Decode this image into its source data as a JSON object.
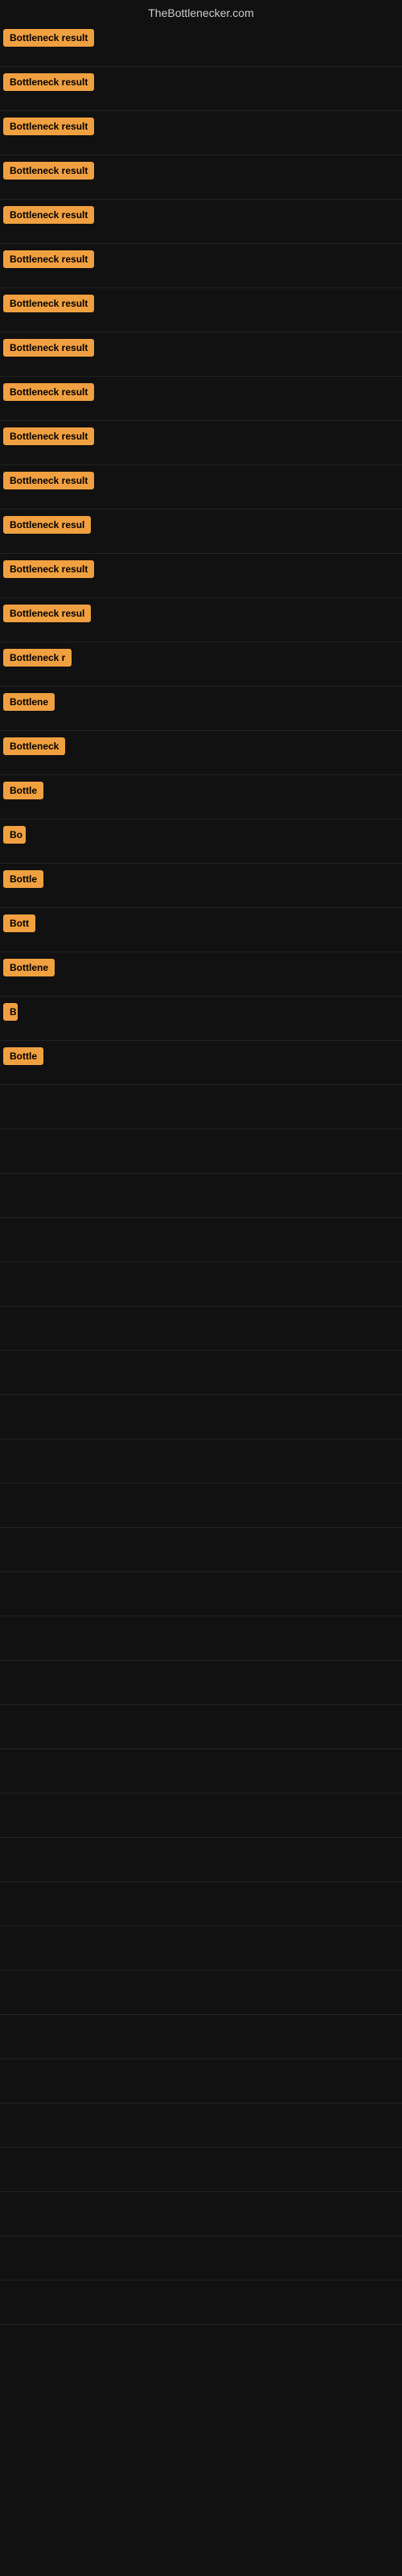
{
  "site": {
    "title": "TheBottlenecker.com"
  },
  "rows": [
    {
      "id": 1,
      "badge_text": "Bottleneck result",
      "width": 140
    },
    {
      "id": 2,
      "badge_text": "Bottleneck result",
      "width": 140
    },
    {
      "id": 3,
      "badge_text": "Bottleneck result",
      "width": 140
    },
    {
      "id": 4,
      "badge_text": "Bottleneck result",
      "width": 140
    },
    {
      "id": 5,
      "badge_text": "Bottleneck result",
      "width": 140
    },
    {
      "id": 6,
      "badge_text": "Bottleneck result",
      "width": 140
    },
    {
      "id": 7,
      "badge_text": "Bottleneck result",
      "width": 140
    },
    {
      "id": 8,
      "badge_text": "Bottleneck result",
      "width": 140
    },
    {
      "id": 9,
      "badge_text": "Bottleneck result",
      "width": 140
    },
    {
      "id": 10,
      "badge_text": "Bottleneck result",
      "width": 140
    },
    {
      "id": 11,
      "badge_text": "Bottleneck result",
      "width": 140
    },
    {
      "id": 12,
      "badge_text": "Bottleneck resul",
      "width": 120
    },
    {
      "id": 13,
      "badge_text": "Bottleneck result",
      "width": 130
    },
    {
      "id": 14,
      "badge_text": "Bottleneck resul",
      "width": 110
    },
    {
      "id": 15,
      "badge_text": "Bottleneck r",
      "width": 90
    },
    {
      "id": 16,
      "badge_text": "Bottlene",
      "width": 72
    },
    {
      "id": 17,
      "badge_text": "Bottleneck",
      "width": 78
    },
    {
      "id": 18,
      "badge_text": "Bottle",
      "width": 58
    },
    {
      "id": 19,
      "badge_text": "Bo",
      "width": 28
    },
    {
      "id": 20,
      "badge_text": "Bottle",
      "width": 55
    },
    {
      "id": 21,
      "badge_text": "Bott",
      "width": 42
    },
    {
      "id": 22,
      "badge_text": "Bottlene",
      "width": 68
    },
    {
      "id": 23,
      "badge_text": "B",
      "width": 18
    },
    {
      "id": 24,
      "badge_text": "Bottle",
      "width": 55
    }
  ],
  "colors": {
    "background": "#111111",
    "badge_bg": "#f0a040",
    "badge_text": "#000000",
    "site_title": "#cccccc",
    "row_border": "#222222"
  }
}
